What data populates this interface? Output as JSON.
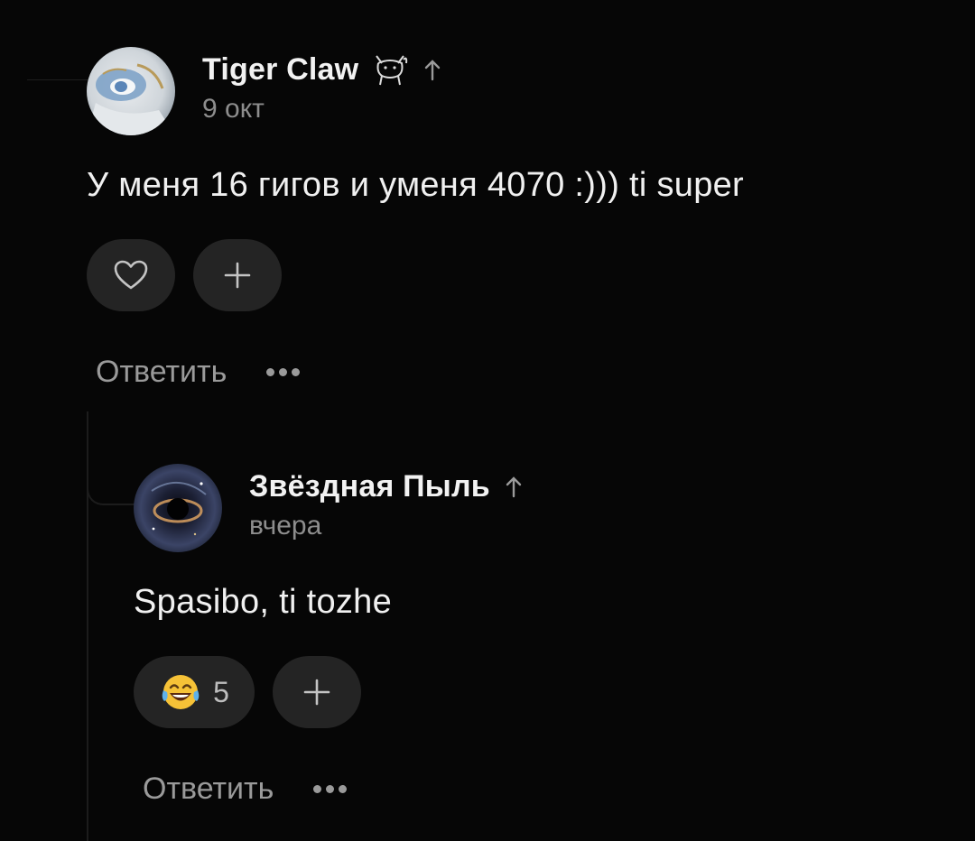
{
  "comments": [
    {
      "author": "Tiger Claw",
      "author_icon": "cat-sticker-icon",
      "date": "9 окт",
      "text": "У меня 16 гигов и уменя 4070 :))) ti super",
      "reactions": [],
      "reply_label": "Ответить"
    },
    {
      "author": "Звёздная Пыль",
      "date": "вчера",
      "text": "Spasibo, ti tozhe",
      "reactions": [
        {
          "emoji": "laughing-crying-emoji",
          "count": "5"
        }
      ],
      "reply_label": "Ответить"
    }
  ],
  "icons": {
    "like": "heart-icon",
    "add_reaction": "plus-icon",
    "more": "more-horizontal-icon",
    "rank": "arrow-up-icon"
  },
  "colors": {
    "background": "#060606",
    "pill": "#242424",
    "muted_text": "#8d8d8d",
    "primary_text": "#f0f0f0"
  }
}
